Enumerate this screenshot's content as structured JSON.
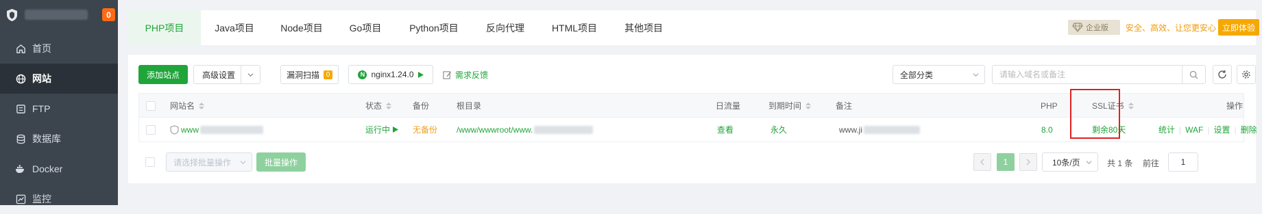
{
  "sidebar": {
    "badge": "0",
    "items": [
      {
        "label": "首页",
        "icon": "home-icon"
      },
      {
        "label": "网站",
        "icon": "globe-icon"
      },
      {
        "label": "FTP",
        "icon": "ftp-icon"
      },
      {
        "label": "数据库",
        "icon": "database-icon"
      },
      {
        "label": "Docker",
        "icon": "docker-icon"
      },
      {
        "label": "监控",
        "icon": "monitor-icon"
      }
    ]
  },
  "tabs": [
    "PHP项目",
    "Java项目",
    "Node项目",
    "Go项目",
    "Python项目",
    "反向代理",
    "HTML项目",
    "其他项目"
  ],
  "enterprise": {
    "badge": "企业版",
    "text": "安全、高效、让您更安心",
    "button": "立即体验"
  },
  "toolbar": {
    "add_site": "添加站点",
    "advanced": "高级设置",
    "vuln_scan": "漏洞扫描",
    "vuln_count": "0",
    "nginx": "nginx1.24.0",
    "feedback": "需求反馈",
    "category": "全部分类",
    "search_placeholder": "请输入域名或备注"
  },
  "table": {
    "headers": {
      "name": "网站名",
      "status": "状态",
      "backup": "备份",
      "root": "根目录",
      "traffic": "日流量",
      "expire": "到期时间",
      "note": "备注",
      "php": "PHP",
      "ssl": "SSL证书",
      "actions": "操作"
    },
    "rows": [
      {
        "name": "www",
        "status": "运行中",
        "backup": "无备份",
        "root": "/www/wwwroot/www.",
        "traffic": "查看",
        "expire": "永久",
        "note": "www.ji",
        "php": "8.0",
        "ssl": "剩余80天",
        "actions": [
          "统计",
          "WAF",
          "设置",
          "删除"
        ]
      }
    ]
  },
  "footer": {
    "batch_placeholder": "请选择批量操作",
    "batch_button": "批量操作",
    "current_page": "1",
    "page_size": "10条/页",
    "total": "共 1 条",
    "goto_label": "前往",
    "goto_value": "1"
  },
  "colors": {
    "brand_green": "#20a53a",
    "sidebar_bg": "#3c444d",
    "highlight_red": "#e02020",
    "warning_orange": "#f0a020"
  }
}
